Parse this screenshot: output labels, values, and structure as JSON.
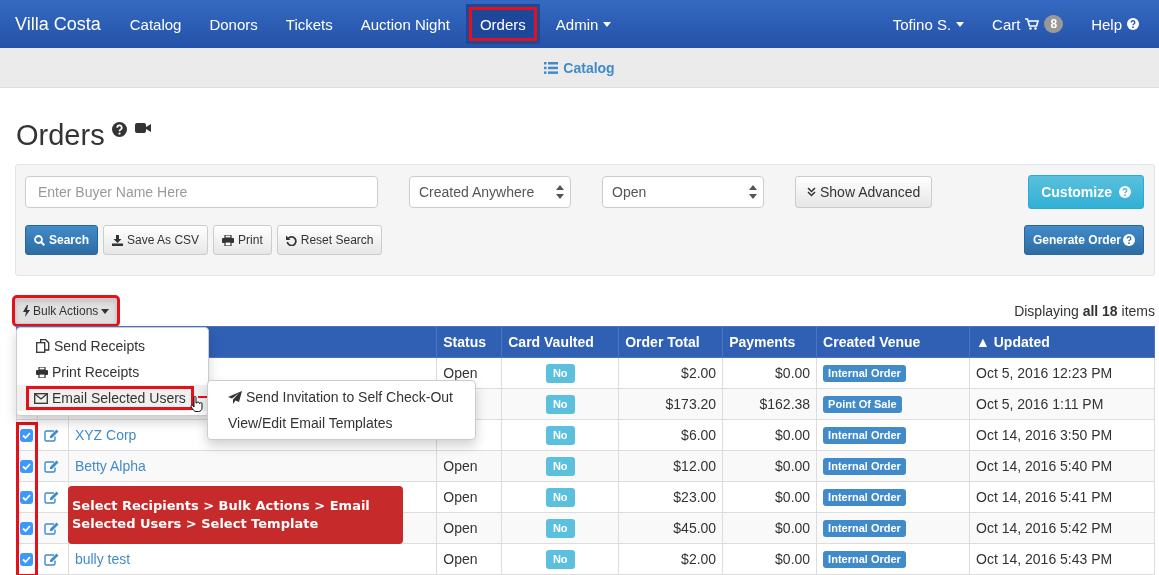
{
  "navbar": {
    "brand": "Villa Costa",
    "items": [
      {
        "label": "Catalog",
        "selected": false,
        "dropdown": false,
        "highlighted": false
      },
      {
        "label": "Donors",
        "selected": false,
        "dropdown": false,
        "highlighted": false
      },
      {
        "label": "Tickets",
        "selected": false,
        "dropdown": false,
        "highlighted": false
      },
      {
        "label": "Auction Night",
        "selected": false,
        "dropdown": false,
        "highlighted": false
      },
      {
        "label": "Orders",
        "selected": true,
        "dropdown": false,
        "highlighted": true
      },
      {
        "label": "Admin",
        "selected": false,
        "dropdown": true,
        "highlighted": false
      }
    ],
    "right_items": [
      {
        "label": "Tofino S.",
        "kind": "dropdown"
      },
      {
        "label": "Cart",
        "kind": "cart",
        "badge": "8"
      },
      {
        "label": "Help",
        "kind": "help"
      }
    ]
  },
  "subnav": {
    "link": "Catalog"
  },
  "page": {
    "title": "Orders"
  },
  "filters": {
    "search": {
      "placeholder": "Enter Buyer Name Here"
    },
    "selects": [
      {
        "value": "Created Anywhere"
      },
      {
        "value": "Open"
      }
    ],
    "show_advanced": "Show Advanced",
    "customize": "Customize",
    "buttons": [
      {
        "label": "Search",
        "kind": "search"
      },
      {
        "label": "Save As CSV",
        "kind": "csv"
      },
      {
        "label": "Print",
        "kind": "print"
      },
      {
        "label": "Reset Search",
        "kind": "reset"
      }
    ],
    "generate_order": "Generate Order"
  },
  "bulk_actions": {
    "label": "Bulk Actions",
    "highlighted": true,
    "expanded": true,
    "menu": [
      {
        "label": "Send Receipts",
        "kind": "copy",
        "highlighted": false
      },
      {
        "label": "Print Receipts",
        "kind": "print",
        "highlighted": false
      },
      {
        "label": "Email Selected Users",
        "kind": "email",
        "highlighted": true,
        "submenu": [
          {
            "label": "Send Invitation to Self Check-Out",
            "kind": "send"
          },
          {
            "label": "View/Edit Email Templates",
            "kind": "plain"
          }
        ]
      }
    ]
  },
  "display_count": "Displaying **all 18** items",
  "table": {
    "checkbox_column_highlighted": true,
    "columns": [
      "Status",
      "Card Vaulted",
      "Order Total",
      "Payments",
      "Created Venue",
      "▲ Updated"
    ],
    "rows": [
      {
        "status": "Open",
        "card_vaulted": "No",
        "order_total": "$2.00",
        "payments": "$0.00",
        "venue": "Internal Order",
        "updated": "Oct 5, 2016 12:23 PM"
      },
      {
        "card_vaulted": "No",
        "order_total": "$173.20",
        "payments": "$162.38",
        "venue": "Point Of Sale",
        "updated": "Oct 5, 2016 1:11 PM"
      },
      {
        "checked": true,
        "name": "XYZ Corp",
        "card_vaulted": "No",
        "order_total": "$6.00",
        "payments": "$0.00",
        "venue": "Internal Order",
        "updated": "Oct 14, 2016 3:50 PM"
      },
      {
        "checked": true,
        "name": "Betty Alpha",
        "status": "Open",
        "card_vaulted": "No",
        "order_total": "$12.00",
        "payments": "$0.00",
        "venue": "Internal Order",
        "updated": "Oct 14, 2016 5:40 PM"
      },
      {
        "checked": true,
        "status": "Open",
        "card_vaulted": "No",
        "order_total": "$23.00",
        "payments": "$0.00",
        "venue": "Internal Order",
        "updated": "Oct 14, 2016 5:41 PM"
      },
      {
        "checked": true,
        "status": "Open",
        "card_vaulted": "No",
        "order_total": "$45.00",
        "payments": "$0.00",
        "venue": "Internal Order",
        "updated": "Oct 14, 2016 5:42 PM"
      },
      {
        "checked": true,
        "name": "bully test",
        "status": "Open",
        "card_vaulted": "No",
        "order_total": "$2.00",
        "payments": "$0.00",
        "venue": "Internal Order",
        "updated": "Oct 14, 2016 5:43 PM"
      }
    ]
  },
  "callout": "Select Recipients > Bulk Actions > Email Selected Users > Select Template"
}
